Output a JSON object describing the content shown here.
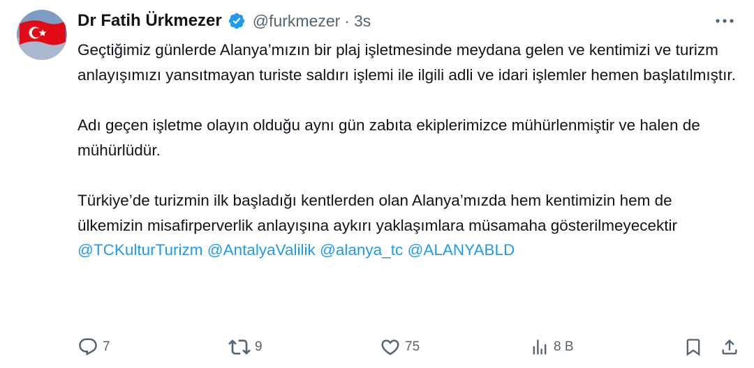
{
  "author": {
    "name": "Dr Fatih Ürkmezer",
    "handle": "@furkmezer",
    "separator": "·",
    "time": "3s",
    "avatar_icon": "turkish-flag-avatar",
    "verified_icon": "verified-badge-icon"
  },
  "colors": {
    "accent": "#1d9bf0",
    "text": "#0f1419",
    "muted": "#536471",
    "flag_red": "#e30a17"
  },
  "tweet": {
    "paragraph1": "Geçtiğimiz günlerde Alanya’mızın bir plaj işletmesinde meydana gelen ve kentimizi ve turizm anlayışımızı yansıtmayan turiste saldırı işlemi ile ilgili adli ve idari işlemler hemen başlatılmıştır.",
    "paragraph2": "Adı geçen işletme olayın olduğu aynı gün zabıta ekiplerimizce mühürlenmiştir ve halen de mühürlüdür.",
    "paragraph3": "Türkiye’de turizmin ilk başladığı kentlerden olan Alanya’mızda hem kentimizin hem de ülkemizin misafirperverlik anlayışına aykırı yaklaşımlara müsamaha gösterilmeyecektir",
    "mentions": [
      "@TCKulturTurizm",
      "@AntalyaValilik",
      "@alanya_tc",
      "@ALANYABLD"
    ]
  },
  "actions": {
    "reply_count": "7",
    "retweet_count": "9",
    "like_count": "75",
    "views_count": "8 B"
  }
}
